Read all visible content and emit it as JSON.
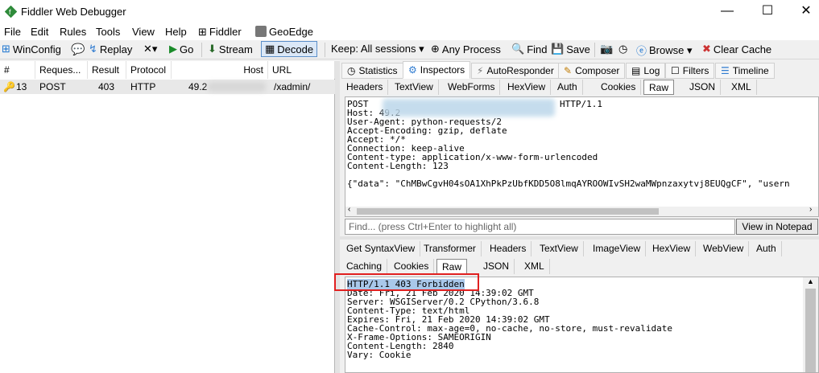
{
  "window": {
    "title": "Fiddler Web Debugger",
    "minimize": "—",
    "maximize": "☐",
    "close": "✕"
  },
  "menu": [
    "File",
    "Edit",
    "Rules",
    "Tools",
    "View",
    "Help",
    "Fiddler",
    "GeoEdge"
  ],
  "toolbar": {
    "winconfig": "WinConfig",
    "replay": "Replay",
    "remove": "✕▾",
    "go": "Go",
    "stream": "Stream",
    "decode": "Decode",
    "keep": "Keep: All sessions ▾",
    "any_process": "Any Process",
    "find": "Find",
    "save": "Save",
    "browse": "Browse ▾",
    "clear_cache": "Clear Cache"
  },
  "sessions": {
    "columns": [
      "#",
      "Reques...",
      "Result",
      "Protocol",
      "Host",
      "URL"
    ],
    "rows": [
      {
        "id": "13",
        "method": "POST",
        "result": "403",
        "protocol": "HTTP",
        "host": "49.2",
        "url": "/xadmin/"
      }
    ]
  },
  "top_tabs": [
    "Statistics",
    "Inspectors",
    "AutoResponder",
    "Composer",
    "Log",
    "Filters",
    "Timeline"
  ],
  "request_tabs": [
    "Headers",
    "TextView",
    "WebForms",
    "HexView",
    "Auth",
    "Cookies",
    "Raw",
    "JSON",
    "XML"
  ],
  "request_raw": [
    "POST",
    "Host: 49.2",
    "User-Agent: python-requests/2",
    "Accept-Encoding: gzip, deflate",
    "Accept: */*",
    "Connection: keep-alive",
    "Content-type: application/x-www-form-urlencoded",
    "Content-Length: 123",
    "",
    "{\"data\": \"ChMBwCgvH04sOA1XhPkPzUbfKDD5O8lmqAYROOWIvSH2waMWpnzaxytvj8EUQgCF\", \"usern"
  ],
  "request_http_version": "HTTP/1.1",
  "find": {
    "placeholder": "Find... (press Ctrl+Enter to highlight all)",
    "button": "View in Notepad"
  },
  "response_tabs_row1": [
    "Get SyntaxView",
    "Transformer",
    "Headers",
    "TextView",
    "ImageView",
    "HexView",
    "WebView",
    "Auth"
  ],
  "response_tabs_row2": [
    "Caching",
    "Cookies",
    "Raw",
    "JSON",
    "XML"
  ],
  "response_raw": [
    "HTTP/1.1 403 Forbidden",
    "Date: Fri, 21 Feb 2020 14:39:02 GMT",
    "Server: WSGIServer/0.2 CPython/3.6.8",
    "Content-Type: text/html",
    "Expires: Fri, 21 Feb 2020 14:39:02 GMT",
    "Cache-Control: max-age=0, no-cache, no-store, must-revalidate",
    "X-Frame-Options: SAMEORIGIN",
    "Content-Length: 2840",
    "Vary: Cookie"
  ]
}
